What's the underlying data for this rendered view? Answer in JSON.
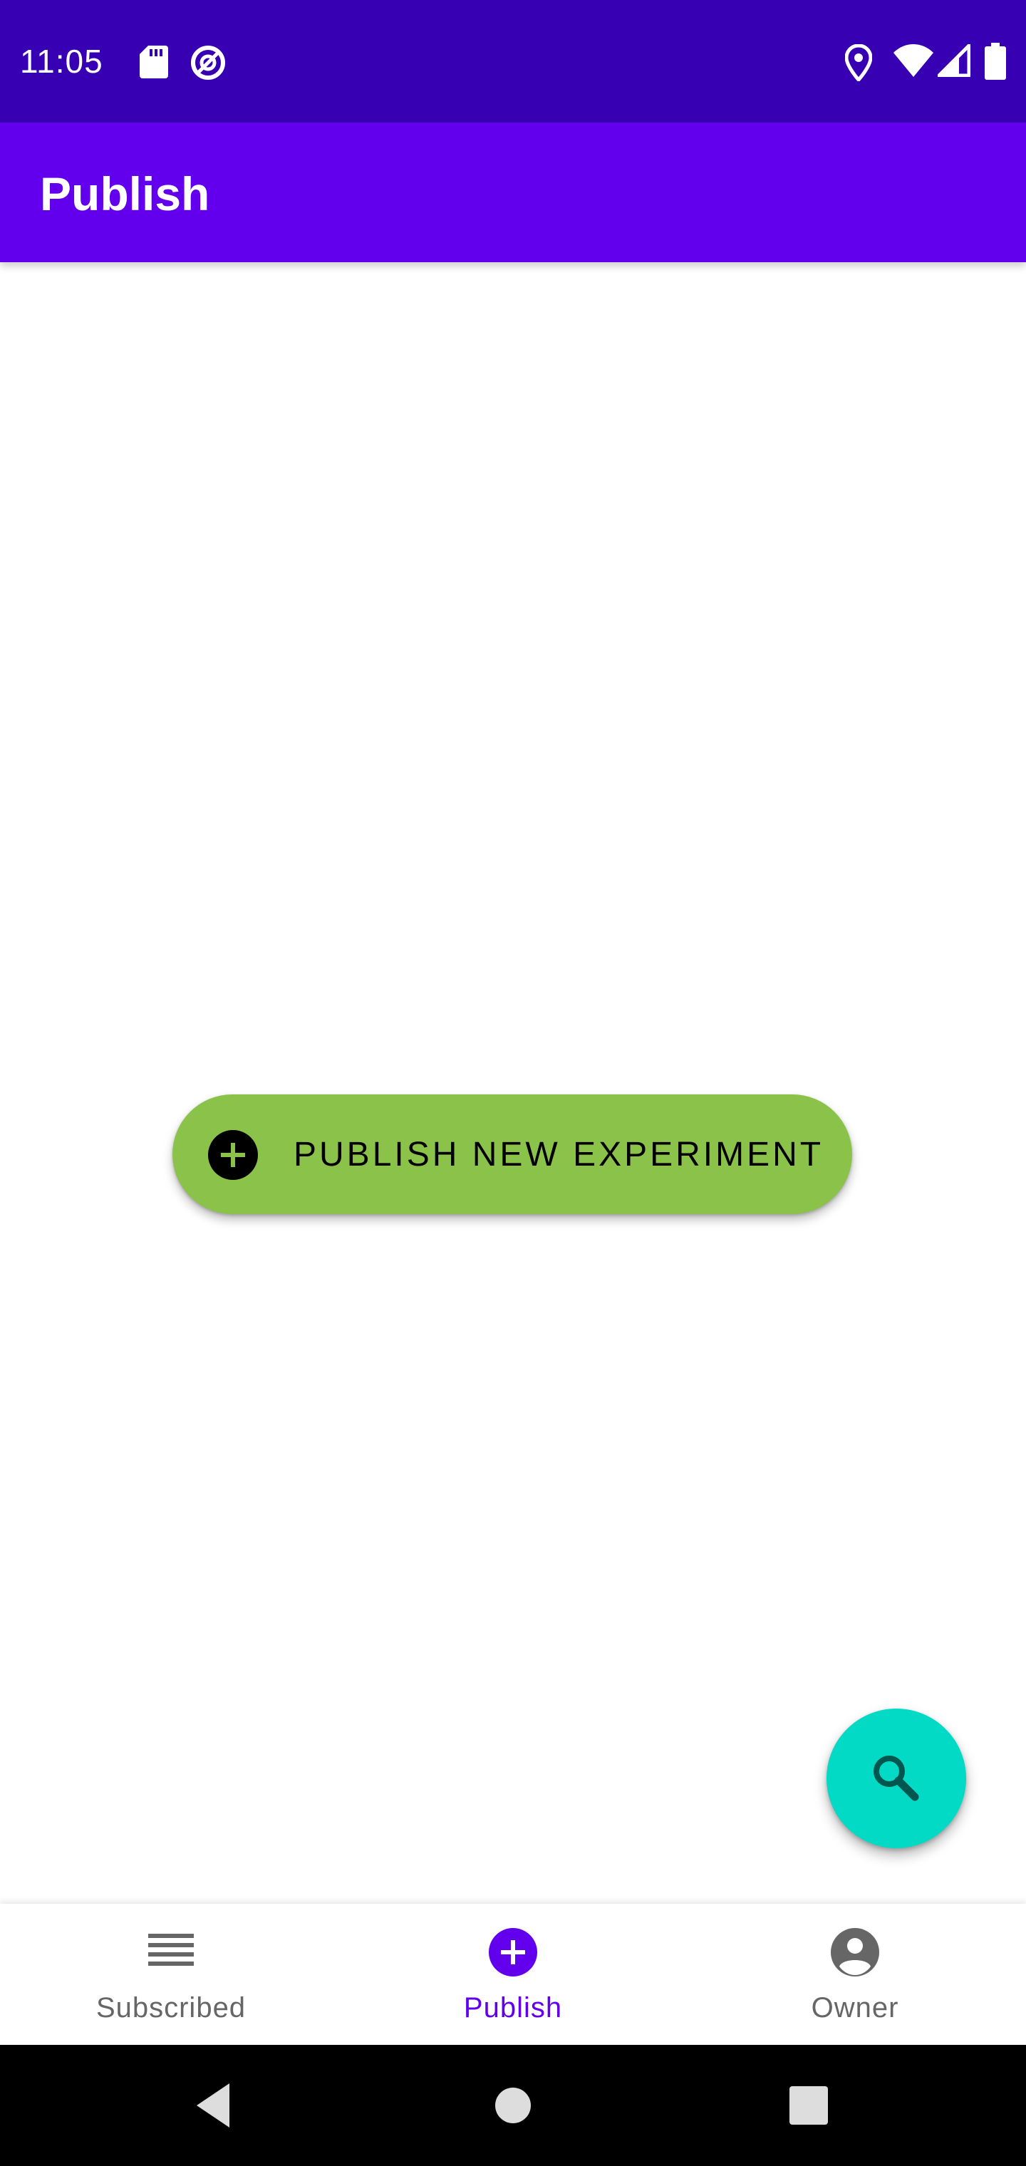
{
  "status_bar": {
    "time": "11:05",
    "left_icons": [
      "sd-card-icon",
      "data-saver-icon"
    ],
    "right_icons": [
      "location-icon",
      "wifi-icon",
      "cell-signal-icon",
      "battery-icon"
    ]
  },
  "app_bar": {
    "title": "Publish"
  },
  "main": {
    "publish_button": {
      "label": "PUBLISH NEW EXPERIMENT",
      "icon": "add-circle-icon"
    },
    "search_fab": {
      "icon": "search-icon"
    }
  },
  "bottom_nav": {
    "items": [
      {
        "label": "Subscribed",
        "icon": "list-icon",
        "active": false
      },
      {
        "label": "Publish",
        "icon": "add-circle-icon",
        "active": true
      },
      {
        "label": "Owner",
        "icon": "account-circle-icon",
        "active": false
      }
    ]
  },
  "system_nav": {
    "buttons": [
      "back-icon",
      "home-icon",
      "recents-icon"
    ]
  },
  "colors": {
    "status_bar": "#3700b3",
    "app_bar": "#6200ee",
    "publish_button": "#8bc34a",
    "search_fab": "#03dac5",
    "nav_active": "#6200ee",
    "nav_inactive": "#666666"
  }
}
